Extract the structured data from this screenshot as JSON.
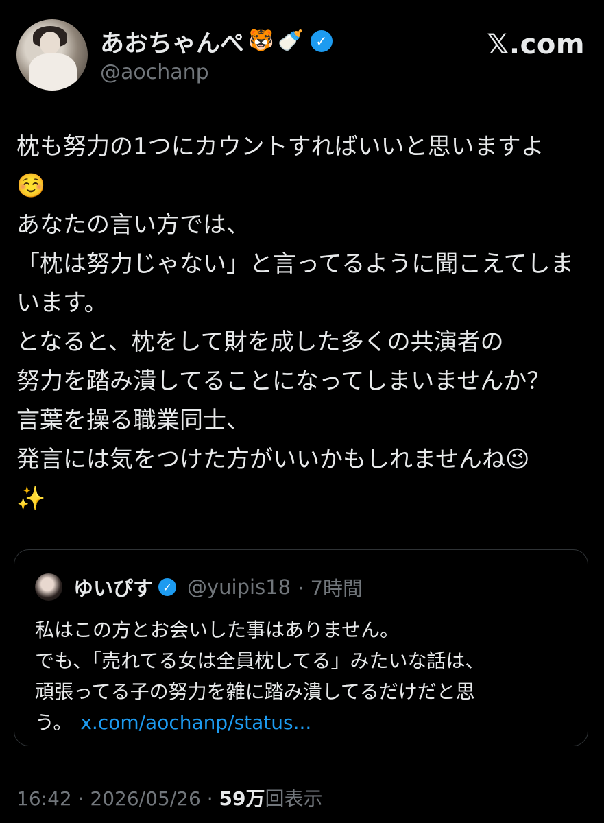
{
  "header": {
    "display_name": "あおちゃんぺ",
    "name_emojis": [
      "🐯",
      "🍼"
    ],
    "handle": "@aochanp",
    "brand": "𝕏.com"
  },
  "tweet": {
    "lines": [
      "枕も努力の1つにカウントすればいいと思いますよ",
      "☺️",
      "あなたの言い方では、",
      "「枕は努力じゃない」と言ってるように聞こえてしま",
      "います。",
      "となると、枕をして財を成した多くの共演者の",
      "努力を踏み潰してることになってしまいませんか？",
      "言葉を操る職業同士、",
      "発言には気をつけた方がいいかもしれませんね😉",
      "✨"
    ]
  },
  "quote": {
    "display_name": "ゆいぴす",
    "handle": "@yuipis18",
    "time": "· 7時間",
    "lines": [
      "私はこの方とお会いした事はありません。",
      "でも、「売れてる女は全員枕してる」みたいな話は、",
      "頑張ってる子の努力を雑に踏み潰してるだけだと思"
    ],
    "last_line_prefix": "う。",
    "link": "x.com/aochanp/status..."
  },
  "meta": {
    "time": "16:42",
    "date": "2026/05/26",
    "views_count": "59万",
    "views_label": "回表示"
  },
  "colors": {
    "background": "#000000",
    "text": "#e7e9ea",
    "muted": "#71767b",
    "accent": "#1d9bf0",
    "border": "#2f3336"
  },
  "icons": {
    "verified": "verified-badge-icon"
  }
}
